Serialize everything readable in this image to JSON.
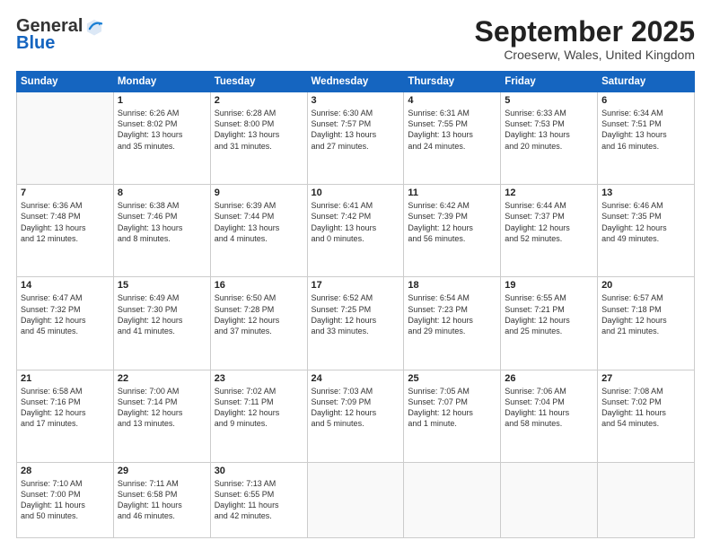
{
  "header": {
    "logo_line1": "General",
    "logo_line2": "Blue",
    "month": "September 2025",
    "location": "Croeserw, Wales, United Kingdom"
  },
  "weekdays": [
    "Sunday",
    "Monday",
    "Tuesday",
    "Wednesday",
    "Thursday",
    "Friday",
    "Saturday"
  ],
  "weeks": [
    [
      {
        "day": "",
        "info": ""
      },
      {
        "day": "1",
        "info": "Sunrise: 6:26 AM\nSunset: 8:02 PM\nDaylight: 13 hours\nand 35 minutes."
      },
      {
        "day": "2",
        "info": "Sunrise: 6:28 AM\nSunset: 8:00 PM\nDaylight: 13 hours\nand 31 minutes."
      },
      {
        "day": "3",
        "info": "Sunrise: 6:30 AM\nSunset: 7:57 PM\nDaylight: 13 hours\nand 27 minutes."
      },
      {
        "day": "4",
        "info": "Sunrise: 6:31 AM\nSunset: 7:55 PM\nDaylight: 13 hours\nand 24 minutes."
      },
      {
        "day": "5",
        "info": "Sunrise: 6:33 AM\nSunset: 7:53 PM\nDaylight: 13 hours\nand 20 minutes."
      },
      {
        "day": "6",
        "info": "Sunrise: 6:34 AM\nSunset: 7:51 PM\nDaylight: 13 hours\nand 16 minutes."
      }
    ],
    [
      {
        "day": "7",
        "info": "Sunrise: 6:36 AM\nSunset: 7:48 PM\nDaylight: 13 hours\nand 12 minutes."
      },
      {
        "day": "8",
        "info": "Sunrise: 6:38 AM\nSunset: 7:46 PM\nDaylight: 13 hours\nand 8 minutes."
      },
      {
        "day": "9",
        "info": "Sunrise: 6:39 AM\nSunset: 7:44 PM\nDaylight: 13 hours\nand 4 minutes."
      },
      {
        "day": "10",
        "info": "Sunrise: 6:41 AM\nSunset: 7:42 PM\nDaylight: 13 hours\nand 0 minutes."
      },
      {
        "day": "11",
        "info": "Sunrise: 6:42 AM\nSunset: 7:39 PM\nDaylight: 12 hours\nand 56 minutes."
      },
      {
        "day": "12",
        "info": "Sunrise: 6:44 AM\nSunset: 7:37 PM\nDaylight: 12 hours\nand 52 minutes."
      },
      {
        "day": "13",
        "info": "Sunrise: 6:46 AM\nSunset: 7:35 PM\nDaylight: 12 hours\nand 49 minutes."
      }
    ],
    [
      {
        "day": "14",
        "info": "Sunrise: 6:47 AM\nSunset: 7:32 PM\nDaylight: 12 hours\nand 45 minutes."
      },
      {
        "day": "15",
        "info": "Sunrise: 6:49 AM\nSunset: 7:30 PM\nDaylight: 12 hours\nand 41 minutes."
      },
      {
        "day": "16",
        "info": "Sunrise: 6:50 AM\nSunset: 7:28 PM\nDaylight: 12 hours\nand 37 minutes."
      },
      {
        "day": "17",
        "info": "Sunrise: 6:52 AM\nSunset: 7:25 PM\nDaylight: 12 hours\nand 33 minutes."
      },
      {
        "day": "18",
        "info": "Sunrise: 6:54 AM\nSunset: 7:23 PM\nDaylight: 12 hours\nand 29 minutes."
      },
      {
        "day": "19",
        "info": "Sunrise: 6:55 AM\nSunset: 7:21 PM\nDaylight: 12 hours\nand 25 minutes."
      },
      {
        "day": "20",
        "info": "Sunrise: 6:57 AM\nSunset: 7:18 PM\nDaylight: 12 hours\nand 21 minutes."
      }
    ],
    [
      {
        "day": "21",
        "info": "Sunrise: 6:58 AM\nSunset: 7:16 PM\nDaylight: 12 hours\nand 17 minutes."
      },
      {
        "day": "22",
        "info": "Sunrise: 7:00 AM\nSunset: 7:14 PM\nDaylight: 12 hours\nand 13 minutes."
      },
      {
        "day": "23",
        "info": "Sunrise: 7:02 AM\nSunset: 7:11 PM\nDaylight: 12 hours\nand 9 minutes."
      },
      {
        "day": "24",
        "info": "Sunrise: 7:03 AM\nSunset: 7:09 PM\nDaylight: 12 hours\nand 5 minutes."
      },
      {
        "day": "25",
        "info": "Sunrise: 7:05 AM\nSunset: 7:07 PM\nDaylight: 12 hours\nand 1 minute."
      },
      {
        "day": "26",
        "info": "Sunrise: 7:06 AM\nSunset: 7:04 PM\nDaylight: 11 hours\nand 58 minutes."
      },
      {
        "day": "27",
        "info": "Sunrise: 7:08 AM\nSunset: 7:02 PM\nDaylight: 11 hours\nand 54 minutes."
      }
    ],
    [
      {
        "day": "28",
        "info": "Sunrise: 7:10 AM\nSunset: 7:00 PM\nDaylight: 11 hours\nand 50 minutes."
      },
      {
        "day": "29",
        "info": "Sunrise: 7:11 AM\nSunset: 6:58 PM\nDaylight: 11 hours\nand 46 minutes."
      },
      {
        "day": "30",
        "info": "Sunrise: 7:13 AM\nSunset: 6:55 PM\nDaylight: 11 hours\nand 42 minutes."
      },
      {
        "day": "",
        "info": ""
      },
      {
        "day": "",
        "info": ""
      },
      {
        "day": "",
        "info": ""
      },
      {
        "day": "",
        "info": ""
      }
    ]
  ]
}
